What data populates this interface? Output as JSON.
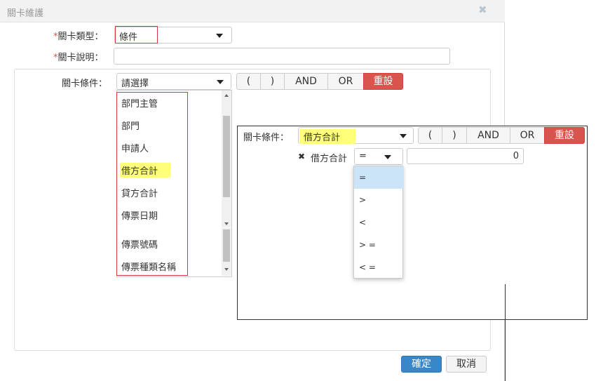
{
  "dialog": {
    "title": "關卡維護",
    "close_icon": "✖",
    "type_field": {
      "required_mark": "*",
      "label": "關卡類型：",
      "value": "條件"
    },
    "desc_field": {
      "required_mark": "*",
      "label": "關卡說明：",
      "value": ""
    },
    "condition_row": {
      "label": "關卡條件：",
      "select_value": "請選擇",
      "buttons": [
        "(",
        ")",
        "AND",
        "OR"
      ],
      "reset_label": "重設"
    },
    "field_list": {
      "items": [
        "部門主管",
        "部門",
        "申請人",
        "借方合計",
        "貸方合計",
        "傳票日期",
        "傳票號碼",
        "傳票種類名稱"
      ],
      "highlighted": "借方合計"
    },
    "footer": {
      "ok_label": "確定",
      "cancel_label": "取消"
    }
  },
  "callout": {
    "label": "關卡條件：",
    "select_value": "借方合計",
    "buttons": [
      "(",
      ")",
      "AND",
      "OR"
    ],
    "reset_label": "重設",
    "condition": {
      "remove_icon": "✖",
      "field_label": "借方合計",
      "operator_value": "=",
      "input_value": "0"
    },
    "operators": [
      "=",
      ">",
      "<",
      "> =",
      "< ="
    ]
  },
  "colors": {
    "reset": "#d9534f",
    "primary": "#3a87c8",
    "highlight": "#ffff7a",
    "outline": "#d9363e"
  }
}
